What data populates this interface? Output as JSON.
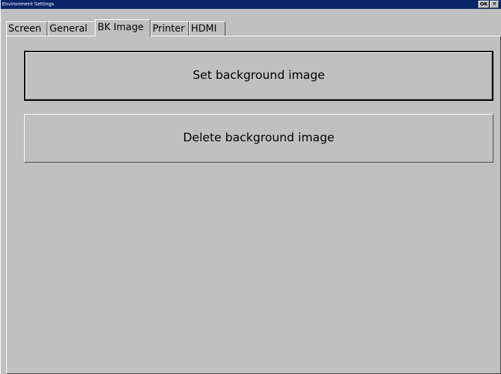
{
  "window": {
    "title": "Environment Settings",
    "ok_label": "OK",
    "close_label": "×"
  },
  "tabs": [
    {
      "label": "Screen",
      "active": false
    },
    {
      "label": "General",
      "active": false
    },
    {
      "label": "BK Image",
      "active": true
    },
    {
      "label": "Printer",
      "active": false
    },
    {
      "label": "HDMI",
      "active": false
    }
  ],
  "bk_image": {
    "set_label": "Set background image",
    "delete_label": "Delete background image"
  },
  "colors": {
    "titlebar": "#0a246a",
    "face": "#c0c0c0"
  }
}
